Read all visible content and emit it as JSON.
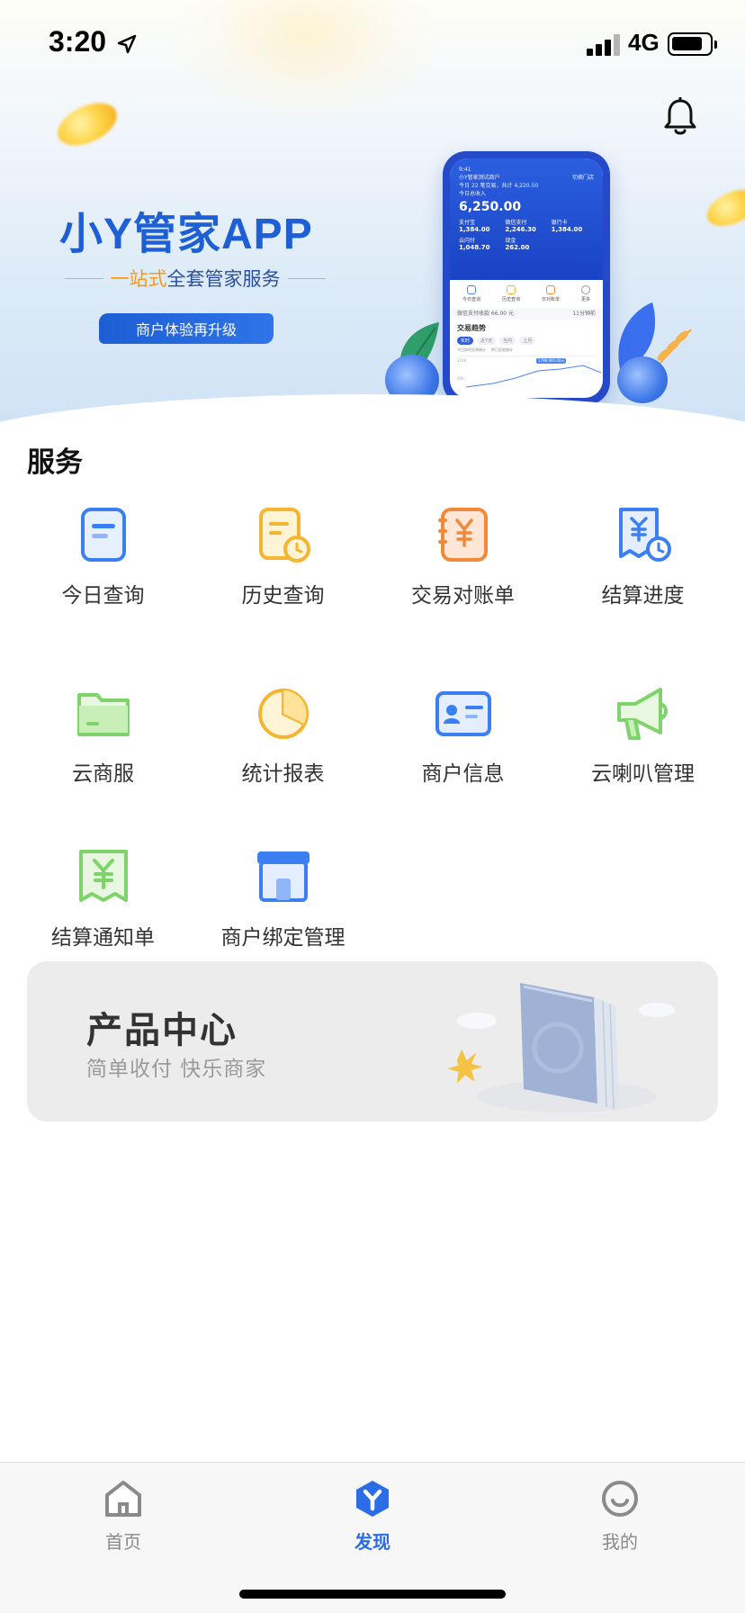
{
  "status_bar": {
    "time": "3:20",
    "network": "4G",
    "icons": [
      "location-arrow-icon",
      "signal-icon",
      "battery-icon"
    ]
  },
  "banner": {
    "title": "小Y管家APP",
    "subtitle_highlight": "一站式",
    "subtitle_rest": "全套管家服务",
    "pill": "商户体验再升级",
    "phone_mockup": {
      "time": "9:41",
      "merchant": "小Y管家测试商户",
      "switch": "切换门店",
      "today_label": "今日",
      "today_count": "22",
      "today_unit": "笔交易，共计",
      "today_total": "4,220.50",
      "amount_label": "今日总收入",
      "big_amount": "6,250.00",
      "grid": [
        {
          "k": "支付宝",
          "v": "1,384.00"
        },
        {
          "k": "微信支付",
          "v": "2,246.30"
        },
        {
          "k": "银行卡",
          "v": "1,384.00"
        },
        {
          "k": "云闪付",
          "v": "1,048.70"
        },
        {
          "k": "现金",
          "v": "262.00"
        },
        {
          "k": "",
          "v": ""
        }
      ],
      "tabs": [
        "今日查询",
        "历史查询",
        "日对账单",
        "更多"
      ],
      "notice": "微信支付收款 66.00 元",
      "notice_time": "11分钟前",
      "section": "交易趋势",
      "filters": [
        "实时",
        "近7天",
        "当月",
        "上月"
      ],
      "legend": [
        "今日实时交易统计",
        "昨日交易统计"
      ],
      "chart_tooltip": "1798 665.00元",
      "ticks": [
        "1200",
        "600"
      ]
    }
  },
  "bell_icon": "bell-icon",
  "services": {
    "title": "服务",
    "items": [
      {
        "label": "今日查询",
        "icon": "today-query-icon"
      },
      {
        "label": "历史查询",
        "icon": "history-query-icon"
      },
      {
        "label": "交易对账单",
        "icon": "statement-icon"
      },
      {
        "label": "结算进度",
        "icon": "settlement-progress-icon"
      },
      {
        "label": "云商服",
        "icon": "folder-icon"
      },
      {
        "label": "统计报表",
        "icon": "pie-chart-icon"
      },
      {
        "label": "商户信息",
        "icon": "id-card-icon"
      },
      {
        "label": "云喇叭管理",
        "icon": "megaphone-icon"
      },
      {
        "label": "结算通知单",
        "icon": "settlement-notice-icon"
      },
      {
        "label": "商户绑定管理",
        "icon": "store-box-icon"
      }
    ]
  },
  "product_center": {
    "title": "产品中心",
    "subtitle": "简单收付 快乐商家",
    "icon": "book-icon"
  },
  "tabbar": {
    "items": [
      {
        "label": "首页",
        "icon": "home-icon",
        "active": false
      },
      {
        "label": "发现",
        "icon": "discover-icon",
        "active": true
      },
      {
        "label": "我的",
        "icon": "profile-smile-icon",
        "active": false
      }
    ],
    "active_color": "#2b6de6",
    "inactive_color": "#8a8a8a"
  },
  "colors": {
    "brand_blue": "#1f5fd6",
    "accent_orange": "#f39a1a",
    "accent_green": "#7ed36a"
  }
}
